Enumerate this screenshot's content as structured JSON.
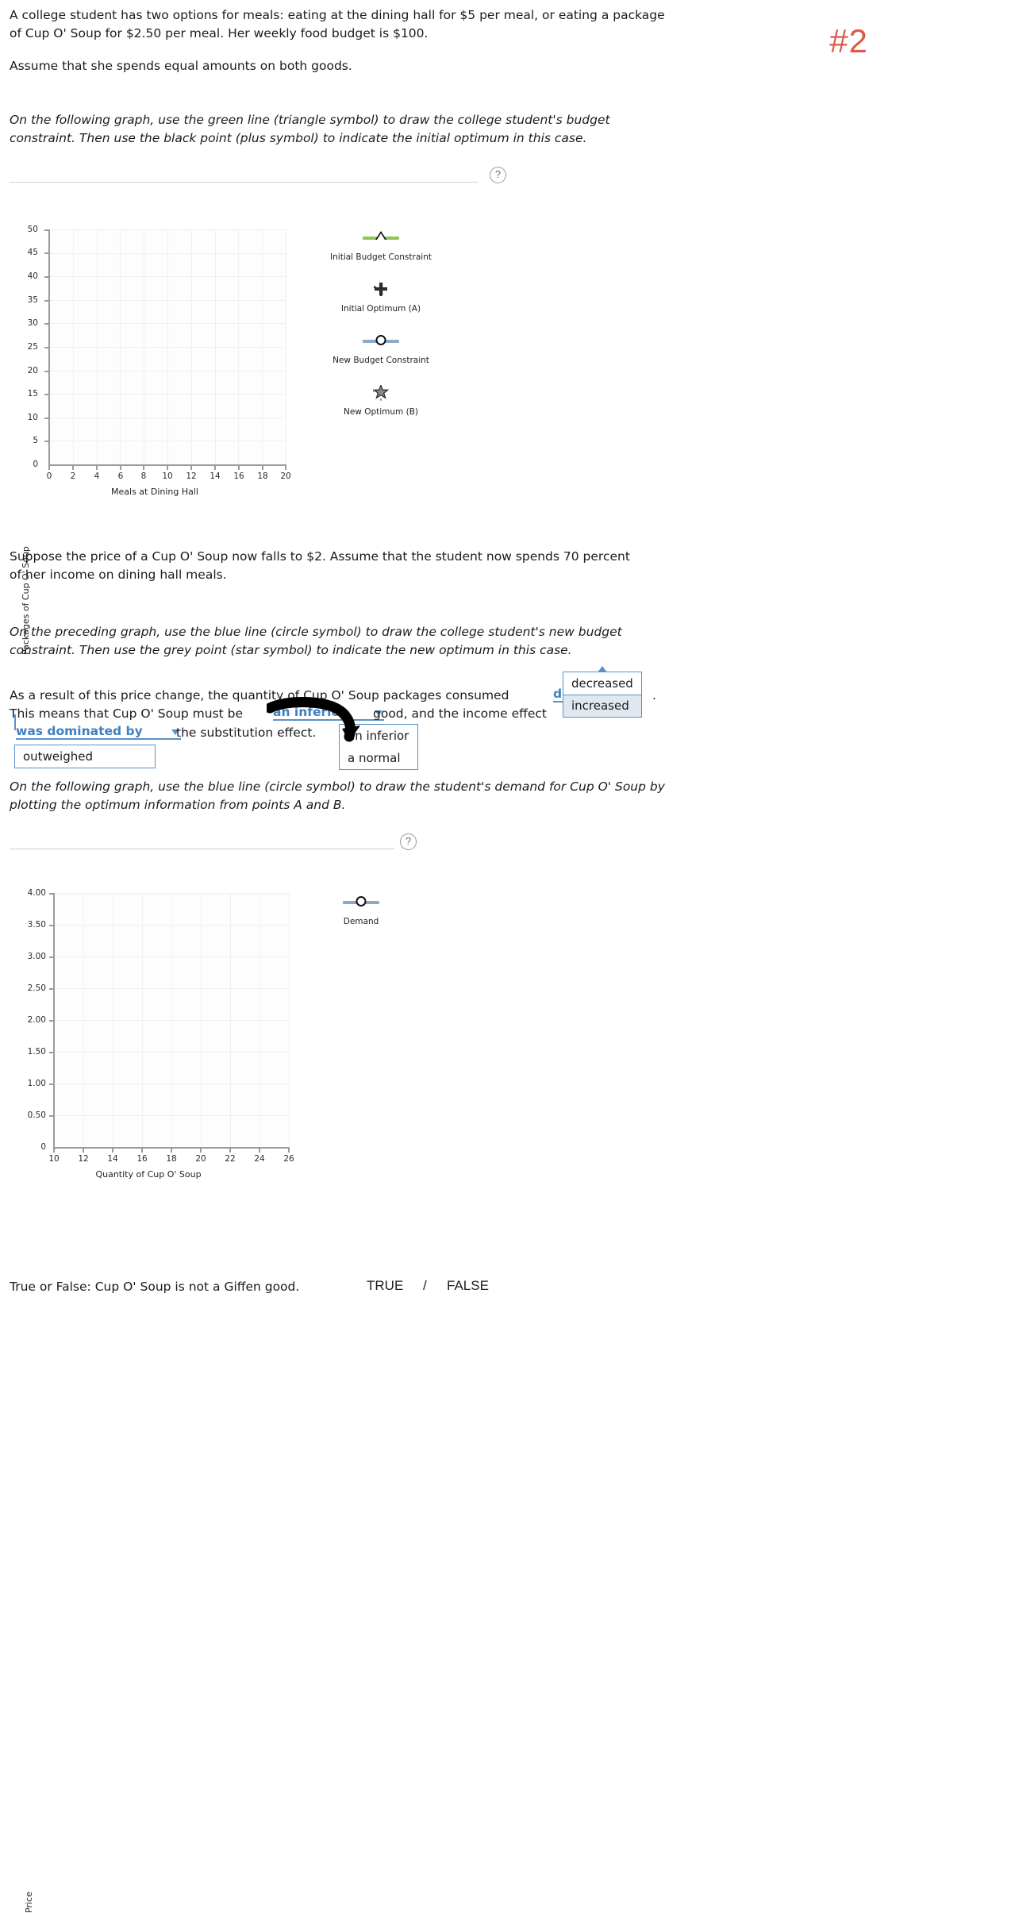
{
  "annotation": {
    "number": "#2"
  },
  "intro": {
    "paragraph1": "A college student has two options for meals: eating at the dining hall for $5 per meal, or eating a package of Cup O' Soup for $2.50 per meal. Her weekly food budget is $100.",
    "paragraph2": "Assume that she spends equal amounts on both goods.",
    "instruction1": "On the following graph, use the green line (triangle symbol) to draw the college student's budget constraint. Then use the black point (plus symbol) to indicate the initial optimum in this case."
  },
  "help_icon": "question-mark",
  "chart_data": [
    {
      "type": "scatter",
      "title": "",
      "xlabel": "Meals at Dining Hall",
      "ylabel": "Packages of Cup O' Soup",
      "xlim": [
        0,
        20
      ],
      "ylim": [
        0,
        50
      ],
      "xticks": [
        "0",
        "2",
        "4",
        "6",
        "8",
        "10",
        "12",
        "14",
        "16",
        "18",
        "20"
      ],
      "yticks": [
        "0",
        "5",
        "10",
        "15",
        "20",
        "25",
        "30",
        "35",
        "40",
        "45",
        "50"
      ],
      "grid": true,
      "legend_position": "right",
      "legend": [
        {
          "label": "Initial Budget Constraint",
          "symbol": "triangle",
          "line": true,
          "color": "#8ec551"
        },
        {
          "label": "Initial Optimum (A)",
          "symbol": "plus",
          "line": false,
          "color": "#2b2b2b"
        },
        {
          "label": "New Budget Constraint",
          "symbol": "circle",
          "line": true,
          "color": "#8ba9ca"
        },
        {
          "label": "New Optimum (B)",
          "symbol": "star",
          "line": false,
          "color": "#8a8a8a"
        }
      ],
      "series": []
    },
    {
      "type": "scatter",
      "title": "",
      "xlabel": "Quantity of Cup O' Soup",
      "ylabel": "Price",
      "xlim": [
        10,
        26
      ],
      "ylim": [
        0,
        4.0
      ],
      "xticks": [
        "10",
        "12",
        "14",
        "16",
        "18",
        "20",
        "22",
        "24",
        "26"
      ],
      "yticks": [
        "0",
        "0.50",
        "1.00",
        "1.50",
        "2.00",
        "2.50",
        "3.00",
        "3.50",
        "4.00"
      ],
      "grid": true,
      "legend_position": "right",
      "legend": [
        {
          "label": "Demand",
          "symbol": "circle",
          "line": true,
          "color": "#8ba9ca"
        }
      ],
      "series": []
    }
  ],
  "middle": {
    "paragraph3": "Suppose the price of a Cup O' Soup now falls to $2. Assume that the student now spends 70 percent of her income on dining hall meals.",
    "instruction2": "On the preceding graph, use the blue line (circle symbol) to draw the college student's new budget constraint. Then use the grey point (star symbol) to indicate the new optimum in this case.",
    "sentence_a_part1": "As a result of this price change, the quantity of Cup O' Soup packages consumed",
    "sentence_a_part2": ".",
    "sentence_b_part1": "This means that Cup O' Soup must be",
    "sentence_b_part2": "good, and the income effect",
    "sentence_b_part3": "the substitution effect.",
    "instruction3": "On the following graph, use the blue line (circle symbol) to draw the student's demand for Cup O' Soup by plotting the optimum information from points A and B."
  },
  "dropdowns": {
    "quantity_change": {
      "selected": "d",
      "options": [
        "decreased",
        "increased"
      ],
      "open": true,
      "highlighted": "increased"
    },
    "good_type": {
      "selected": "an inferior",
      "options": [
        "an inferior",
        "a normal"
      ],
      "open": true
    },
    "effect_relation": {
      "selected": "",
      "options": [
        "was dominated by",
        "outweighed"
      ],
      "open": true
    }
  },
  "bottom": {
    "question": "True or False: Cup O' Soup is not a Giffen good.",
    "option_true": "TRUE",
    "separator": "/",
    "option_false": "FALSE"
  },
  "colors": {
    "green": "#8ec551",
    "blue": "#8ba9ca",
    "grey_point": "#8a8a8a",
    "black_point": "#2b2b2b",
    "annotation_red": "#e0584a",
    "dropdown_blue": "#5b90c4"
  }
}
